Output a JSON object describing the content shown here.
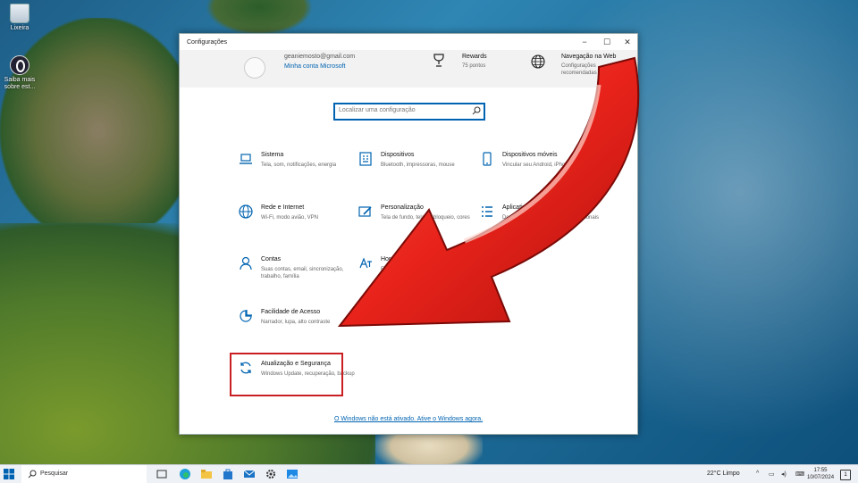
{
  "desktop": {
    "icons": [
      {
        "label": "Lixeira"
      },
      {
        "label": "Saiba mais sobre est..."
      }
    ]
  },
  "window": {
    "title": "Configurações",
    "controls": {
      "minimize": "−",
      "maximize": "☐",
      "close": "✕"
    }
  },
  "account": {
    "email": "geaniemosto@gmail.com",
    "link": "Minha conta Microsoft"
  },
  "rewards": {
    "title": "Rewards",
    "subtitle": "75 pontos"
  },
  "web": {
    "title": "Navegação na Web",
    "subtitle": "Configurações recomendadas"
  },
  "search": {
    "placeholder": "Localizar uma configuração"
  },
  "categories": [
    {
      "title": "Sistema",
      "subtitle": "Tela, som, notificações, energia",
      "icon": "laptop-icon"
    },
    {
      "title": "Dispositivos",
      "subtitle": "Bluetooth, impressoras, mouse",
      "icon": "keyboard-icon"
    },
    {
      "title": "Dispositivos móveis",
      "subtitle": "Vincular seu Android, iPhone",
      "icon": "phone-icon"
    },
    {
      "title": "Rede e Internet",
      "subtitle": "Wi-Fi, modo avião, VPN",
      "icon": "globe-icon"
    },
    {
      "title": "Personalização",
      "subtitle": "Tela de fundo, tela de bloqueio, cores",
      "icon": "brush-icon"
    },
    {
      "title": "Aplicativos",
      "subtitle": "Desinstalar, padrões, recursos opcionais",
      "icon": "apps-icon"
    },
    {
      "title": "Contas",
      "subtitle": "Suas contas, email, sincronização, trabalho, família",
      "icon": "person-icon"
    },
    {
      "title": "Hora e idioma",
      "subtitle": "Fala, região, data",
      "icon": "language-icon"
    },
    {
      "title": "Facilidade de Acesso",
      "subtitle": "Narrador, lupa, alto contraste",
      "icon": "accessibility-icon"
    },
    {
      "title": "Atualização e Segurança",
      "subtitle": "Windows Update, recuperação, backup",
      "icon": "refresh-icon"
    }
  ],
  "activation_link": "O Windows não está ativado. Ative o Windows agora.",
  "taskbar": {
    "search_label": "Pesquisar",
    "weather": "22°C  Limpo",
    "time": "17:55",
    "date": "10/07/2024",
    "notification_count": "1"
  },
  "colors": {
    "accent": "#0063b1",
    "highlight": "#c91f23",
    "arrow": "#e8231b"
  }
}
